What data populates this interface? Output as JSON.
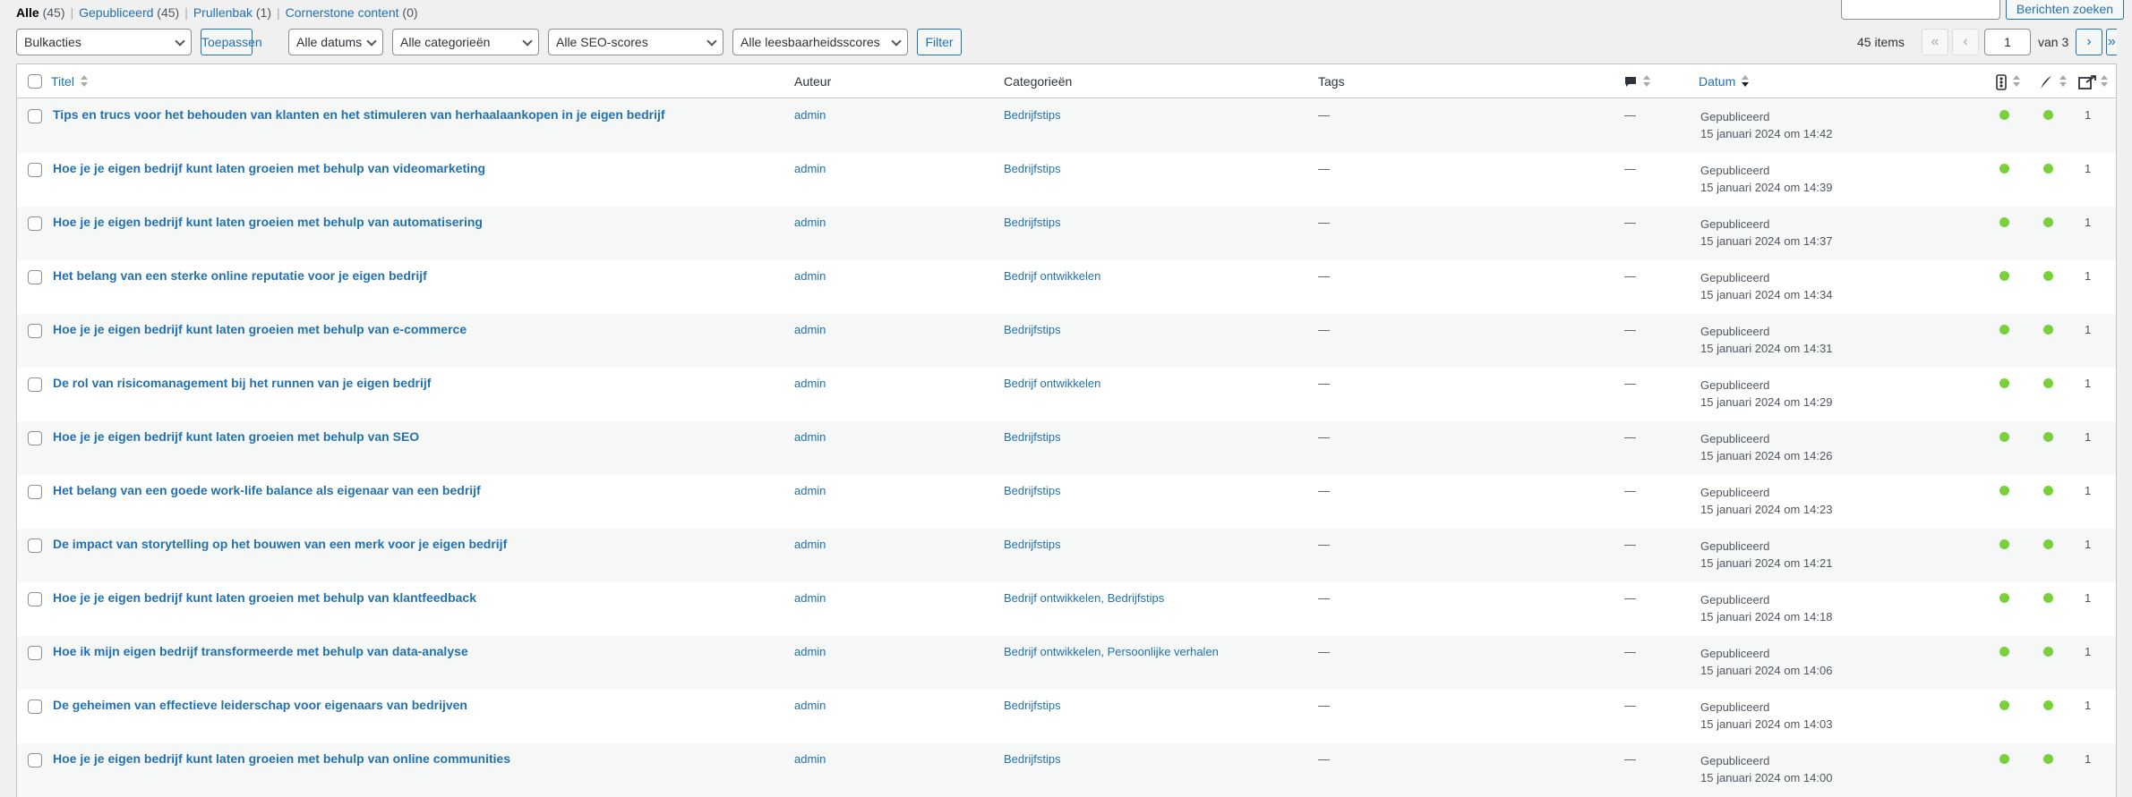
{
  "views": [
    {
      "label": "Alle",
      "count": "(45)",
      "current": true
    },
    {
      "label": "Gepubliceerd",
      "count": "(45)",
      "current": false
    },
    {
      "label": "Prullenbak",
      "count": "(1)",
      "current": false
    },
    {
      "label": "Cornerstone content",
      "count": "(0)",
      "current": false
    }
  ],
  "search": {
    "value": "",
    "button": "Berichten zoeken"
  },
  "filters": {
    "bulk": "Bulkacties",
    "apply": "Toepassen",
    "dates": "Alle datums",
    "categories": "Alle categorieën",
    "seo": "Alle SEO-scores",
    "readability": "Alle leesbaarheidsscores",
    "filter": "Filter"
  },
  "pagination": {
    "items": "45 items",
    "first": "«",
    "prev": "‹",
    "current": "1",
    "of": "van 3",
    "next": "›",
    "last": "»"
  },
  "columns": {
    "title": "Titel",
    "author": "Auteur",
    "categories": "Categorieën",
    "tags": "Tags",
    "date": "Datum"
  },
  "colors": {
    "accent": "#2271b1",
    "good": "#7ad03a"
  },
  "icons": [
    "comments-icon",
    "seo-score-icon",
    "readability-icon",
    "links-icon"
  ],
  "rows": [
    {
      "title": "Tips en trucs voor het behouden van klanten en het stimuleren van herhaalaankopen in je eigen bedrijf",
      "author": "admin",
      "categories": "Bedrijfstips",
      "tags": "—",
      "comments": "—",
      "status": "Gepubliceerd",
      "date": "15 januari 2024 om 14:42",
      "links": "1"
    },
    {
      "title": "Hoe je je eigen bedrijf kunt laten groeien met behulp van videomarketing",
      "author": "admin",
      "categories": "Bedrijfstips",
      "tags": "—",
      "comments": "—",
      "status": "Gepubliceerd",
      "date": "15 januari 2024 om 14:39",
      "links": "1"
    },
    {
      "title": "Hoe je je eigen bedrijf kunt laten groeien met behulp van automatisering",
      "author": "admin",
      "categories": "Bedrijfstips",
      "tags": "—",
      "comments": "—",
      "status": "Gepubliceerd",
      "date": "15 januari 2024 om 14:37",
      "links": "1"
    },
    {
      "title": "Het belang van een sterke online reputatie voor je eigen bedrijf",
      "author": "admin",
      "categories": "Bedrijf ontwikkelen",
      "tags": "—",
      "comments": "—",
      "status": "Gepubliceerd",
      "date": "15 januari 2024 om 14:34",
      "links": "1"
    },
    {
      "title": "Hoe je je eigen bedrijf kunt laten groeien met behulp van e-commerce",
      "author": "admin",
      "categories": "Bedrijfstips",
      "tags": "—",
      "comments": "—",
      "status": "Gepubliceerd",
      "date": "15 januari 2024 om 14:31",
      "links": "1"
    },
    {
      "title": "De rol van risicomanagement bij het runnen van je eigen bedrijf",
      "author": "admin",
      "categories": "Bedrijf ontwikkelen",
      "tags": "—",
      "comments": "—",
      "status": "Gepubliceerd",
      "date": "15 januari 2024 om 14:29",
      "links": "1"
    },
    {
      "title": "Hoe je je eigen bedrijf kunt laten groeien met behulp van SEO",
      "author": "admin",
      "categories": "Bedrijfstips",
      "tags": "—",
      "comments": "—",
      "status": "Gepubliceerd",
      "date": "15 januari 2024 om 14:26",
      "links": "1"
    },
    {
      "title": "Het belang van een goede work-life balance als eigenaar van een bedrijf",
      "author": "admin",
      "categories": "Bedrijfstips",
      "tags": "—",
      "comments": "—",
      "status": "Gepubliceerd",
      "date": "15 januari 2024 om 14:23",
      "links": "1"
    },
    {
      "title": "De impact van storytelling op het bouwen van een merk voor je eigen bedrijf",
      "author": "admin",
      "categories": "Bedrijfstips",
      "tags": "—",
      "comments": "—",
      "status": "Gepubliceerd",
      "date": "15 januari 2024 om 14:21",
      "links": "1"
    },
    {
      "title": "Hoe je je eigen bedrijf kunt laten groeien met behulp van klantfeedback",
      "author": "admin",
      "categories": "Bedrijf ontwikkelen, Bedrijfstips",
      "tags": "—",
      "comments": "—",
      "status": "Gepubliceerd",
      "date": "15 januari 2024 om 14:18",
      "links": "1"
    },
    {
      "title": "Hoe ik mijn eigen bedrijf transformeerde met behulp van data-analyse",
      "author": "admin",
      "categories": "Bedrijf ontwikkelen, Persoonlijke verhalen",
      "tags": "—",
      "comments": "—",
      "status": "Gepubliceerd",
      "date": "15 januari 2024 om 14:06",
      "links": "1"
    },
    {
      "title": "De geheimen van effectieve leiderschap voor eigenaars van bedrijven",
      "author": "admin",
      "categories": "Bedrijfstips",
      "tags": "—",
      "comments": "—",
      "status": "Gepubliceerd",
      "date": "15 januari 2024 om 14:03",
      "links": "1"
    },
    {
      "title": "Hoe je je eigen bedrijf kunt laten groeien met behulp van online communities",
      "author": "admin",
      "categories": "Bedrijfstips",
      "tags": "—",
      "comments": "—",
      "status": "Gepubliceerd",
      "date": "15 januari 2024 om 14:00",
      "links": "1"
    }
  ]
}
